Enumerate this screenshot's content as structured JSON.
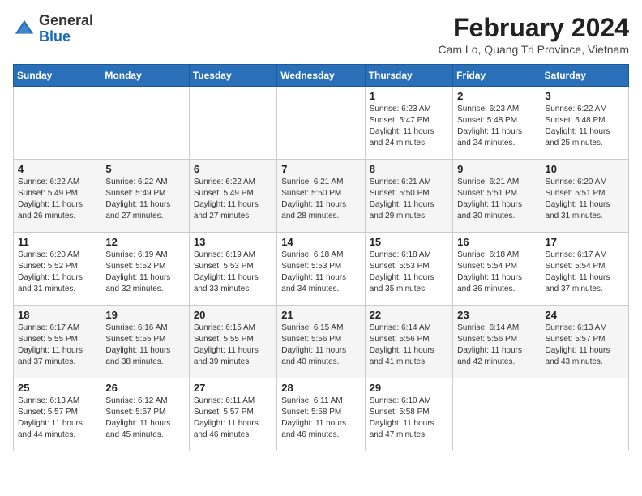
{
  "header": {
    "logo_general": "General",
    "logo_blue": "Blue",
    "title": "February 2024",
    "subtitle": "Cam Lo, Quang Tri Province, Vietnam"
  },
  "days_of_week": [
    "Sunday",
    "Monday",
    "Tuesday",
    "Wednesday",
    "Thursday",
    "Friday",
    "Saturday"
  ],
  "weeks": [
    [
      {
        "day": "",
        "info": ""
      },
      {
        "day": "",
        "info": ""
      },
      {
        "day": "",
        "info": ""
      },
      {
        "day": "",
        "info": ""
      },
      {
        "day": "1",
        "info": "Sunrise: 6:23 AM\nSunset: 5:47 PM\nDaylight: 11 hours and 24 minutes."
      },
      {
        "day": "2",
        "info": "Sunrise: 6:23 AM\nSunset: 5:48 PM\nDaylight: 11 hours and 24 minutes."
      },
      {
        "day": "3",
        "info": "Sunrise: 6:22 AM\nSunset: 5:48 PM\nDaylight: 11 hours and 25 minutes."
      }
    ],
    [
      {
        "day": "4",
        "info": "Sunrise: 6:22 AM\nSunset: 5:49 PM\nDaylight: 11 hours and 26 minutes."
      },
      {
        "day": "5",
        "info": "Sunrise: 6:22 AM\nSunset: 5:49 PM\nDaylight: 11 hours and 27 minutes."
      },
      {
        "day": "6",
        "info": "Sunrise: 6:22 AM\nSunset: 5:49 PM\nDaylight: 11 hours and 27 minutes."
      },
      {
        "day": "7",
        "info": "Sunrise: 6:21 AM\nSunset: 5:50 PM\nDaylight: 11 hours and 28 minutes."
      },
      {
        "day": "8",
        "info": "Sunrise: 6:21 AM\nSunset: 5:50 PM\nDaylight: 11 hours and 29 minutes."
      },
      {
        "day": "9",
        "info": "Sunrise: 6:21 AM\nSunset: 5:51 PM\nDaylight: 11 hours and 30 minutes."
      },
      {
        "day": "10",
        "info": "Sunrise: 6:20 AM\nSunset: 5:51 PM\nDaylight: 11 hours and 31 minutes."
      }
    ],
    [
      {
        "day": "11",
        "info": "Sunrise: 6:20 AM\nSunset: 5:52 PM\nDaylight: 11 hours and 31 minutes."
      },
      {
        "day": "12",
        "info": "Sunrise: 6:19 AM\nSunset: 5:52 PM\nDaylight: 11 hours and 32 minutes."
      },
      {
        "day": "13",
        "info": "Sunrise: 6:19 AM\nSunset: 5:53 PM\nDaylight: 11 hours and 33 minutes."
      },
      {
        "day": "14",
        "info": "Sunrise: 6:18 AM\nSunset: 5:53 PM\nDaylight: 11 hours and 34 minutes."
      },
      {
        "day": "15",
        "info": "Sunrise: 6:18 AM\nSunset: 5:53 PM\nDaylight: 11 hours and 35 minutes."
      },
      {
        "day": "16",
        "info": "Sunrise: 6:18 AM\nSunset: 5:54 PM\nDaylight: 11 hours and 36 minutes."
      },
      {
        "day": "17",
        "info": "Sunrise: 6:17 AM\nSunset: 5:54 PM\nDaylight: 11 hours and 37 minutes."
      }
    ],
    [
      {
        "day": "18",
        "info": "Sunrise: 6:17 AM\nSunset: 5:55 PM\nDaylight: 11 hours and 37 minutes."
      },
      {
        "day": "19",
        "info": "Sunrise: 6:16 AM\nSunset: 5:55 PM\nDaylight: 11 hours and 38 minutes."
      },
      {
        "day": "20",
        "info": "Sunrise: 6:15 AM\nSunset: 5:55 PM\nDaylight: 11 hours and 39 minutes."
      },
      {
        "day": "21",
        "info": "Sunrise: 6:15 AM\nSunset: 5:56 PM\nDaylight: 11 hours and 40 minutes."
      },
      {
        "day": "22",
        "info": "Sunrise: 6:14 AM\nSunset: 5:56 PM\nDaylight: 11 hours and 41 minutes."
      },
      {
        "day": "23",
        "info": "Sunrise: 6:14 AM\nSunset: 5:56 PM\nDaylight: 11 hours and 42 minutes."
      },
      {
        "day": "24",
        "info": "Sunrise: 6:13 AM\nSunset: 5:57 PM\nDaylight: 11 hours and 43 minutes."
      }
    ],
    [
      {
        "day": "25",
        "info": "Sunrise: 6:13 AM\nSunset: 5:57 PM\nDaylight: 11 hours and 44 minutes."
      },
      {
        "day": "26",
        "info": "Sunrise: 6:12 AM\nSunset: 5:57 PM\nDaylight: 11 hours and 45 minutes."
      },
      {
        "day": "27",
        "info": "Sunrise: 6:11 AM\nSunset: 5:57 PM\nDaylight: 11 hours and 46 minutes."
      },
      {
        "day": "28",
        "info": "Sunrise: 6:11 AM\nSunset: 5:58 PM\nDaylight: 11 hours and 46 minutes."
      },
      {
        "day": "29",
        "info": "Sunrise: 6:10 AM\nSunset: 5:58 PM\nDaylight: 11 hours and 47 minutes."
      },
      {
        "day": "",
        "info": ""
      },
      {
        "day": "",
        "info": ""
      }
    ]
  ]
}
